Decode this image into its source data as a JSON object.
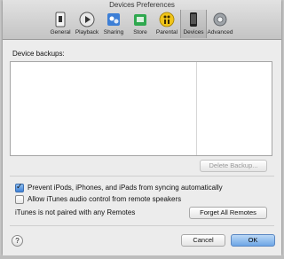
{
  "window": {
    "title": "Devices Preferences"
  },
  "toolbar": {
    "tabs": [
      {
        "label": "General",
        "icon": "general-icon"
      },
      {
        "label": "Playback",
        "icon": "playback-icon"
      },
      {
        "label": "Sharing",
        "icon": "sharing-icon"
      },
      {
        "label": "Store",
        "icon": "store-icon"
      },
      {
        "label": "Parental",
        "icon": "parental-icon"
      },
      {
        "label": "Devices",
        "icon": "devices-icon",
        "selected": true
      },
      {
        "label": "Advanced",
        "icon": "advanced-icon"
      }
    ]
  },
  "backups": {
    "label": "Device backups:",
    "delete_label": "Delete Backup..."
  },
  "options": {
    "prevent_sync_label": "Prevent iPods, iPhones, and iPads from syncing automatically",
    "prevent_sync_checked": true,
    "allow_remote_label": "Allow iTunes audio control from remote speakers",
    "allow_remote_checked": false
  },
  "remotes": {
    "status_text": "iTunes is not paired with any Remotes",
    "forget_label": "Forget All Remotes"
  },
  "footer": {
    "help_label": "?",
    "cancel_label": "Cancel",
    "ok_label": "OK"
  },
  "colors": {
    "accent": "#4f8fe0",
    "window_bg": "#ececec"
  }
}
